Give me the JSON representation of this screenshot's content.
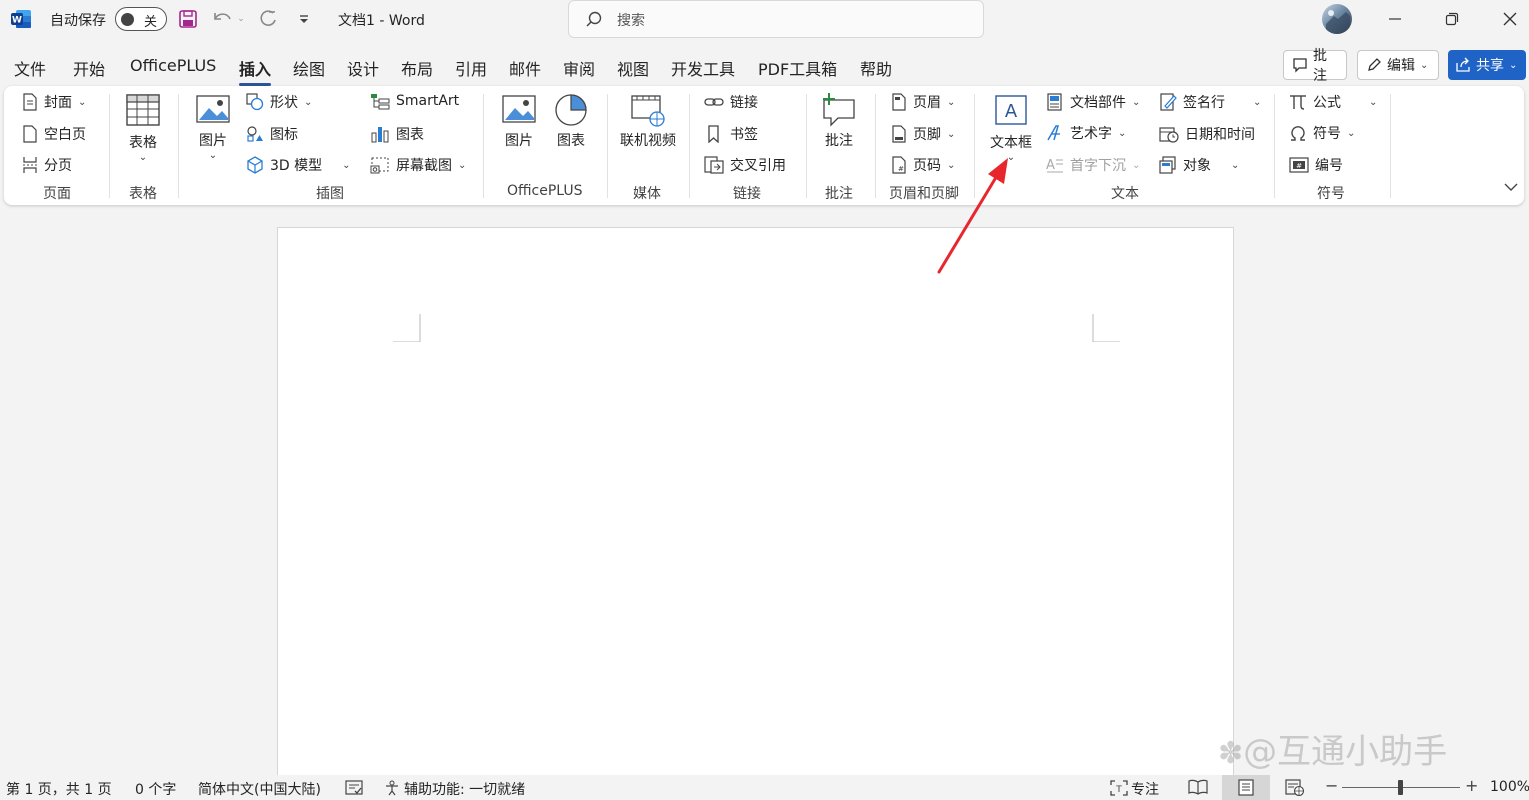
{
  "titlebar": {
    "autosave_label": "自动保存",
    "autosave_state": "关",
    "doc_title": "文档1  -  Word",
    "search_placeholder": "搜索"
  },
  "menu": {
    "tabs": [
      "文件",
      "开始",
      "OfficePLUS",
      "插入",
      "绘图",
      "设计",
      "布局",
      "引用",
      "邮件",
      "审阅",
      "视图",
      "开发工具",
      "PDF工具箱",
      "帮助"
    ],
    "active_tab": "插入",
    "comments_btn": "批注",
    "edit_btn": "编辑",
    "share_btn": "共享"
  },
  "ribbon": {
    "pages": {
      "cover": "封面",
      "blank": "空白页",
      "break": "分页",
      "group": "页面"
    },
    "tables": {
      "table": "表格",
      "group": "表格"
    },
    "illustrations": {
      "pictures": "图片",
      "shapes": "形状",
      "icons": "图标",
      "models3d": "3D 模型",
      "smartart": "SmartArt",
      "chart": "图表",
      "screenshot": "屏幕截图",
      "group": "插图"
    },
    "officeplus": {
      "picture": "图片",
      "chart": "图表",
      "group": "OfficePLUS"
    },
    "media": {
      "online_video": "联机视频",
      "group": "媒体"
    },
    "links": {
      "link": "链接",
      "bookmark": "书签",
      "crossref": "交叉引用",
      "group": "链接"
    },
    "comments": {
      "comment": "批注",
      "group": "批注"
    },
    "headerfooter": {
      "header": "页眉",
      "footer": "页脚",
      "pagenum": "页码",
      "group": "页眉和页脚"
    },
    "text": {
      "textbox": "文本框",
      "quickparts": "文档部件",
      "wordart": "艺术字",
      "dropcap": "首字下沉",
      "signature": "签名行",
      "datetime": "日期和时间",
      "object": "对象",
      "group": "文本"
    },
    "symbols": {
      "equation": "公式",
      "symbol": "符号",
      "numbering": "编号",
      "group": "符号"
    }
  },
  "status": {
    "page": "第 1 页，共 1 页",
    "words": "0 个字",
    "language": "简体中文(中国大陆)",
    "accessibility": "辅助功能: 一切就绪",
    "focus": "专注",
    "zoom": "100%"
  },
  "watermark": "@互通小助手",
  "colors": {
    "accent": "#2b579a",
    "share": "#1f63c6",
    "arrow": "#e8262d"
  }
}
